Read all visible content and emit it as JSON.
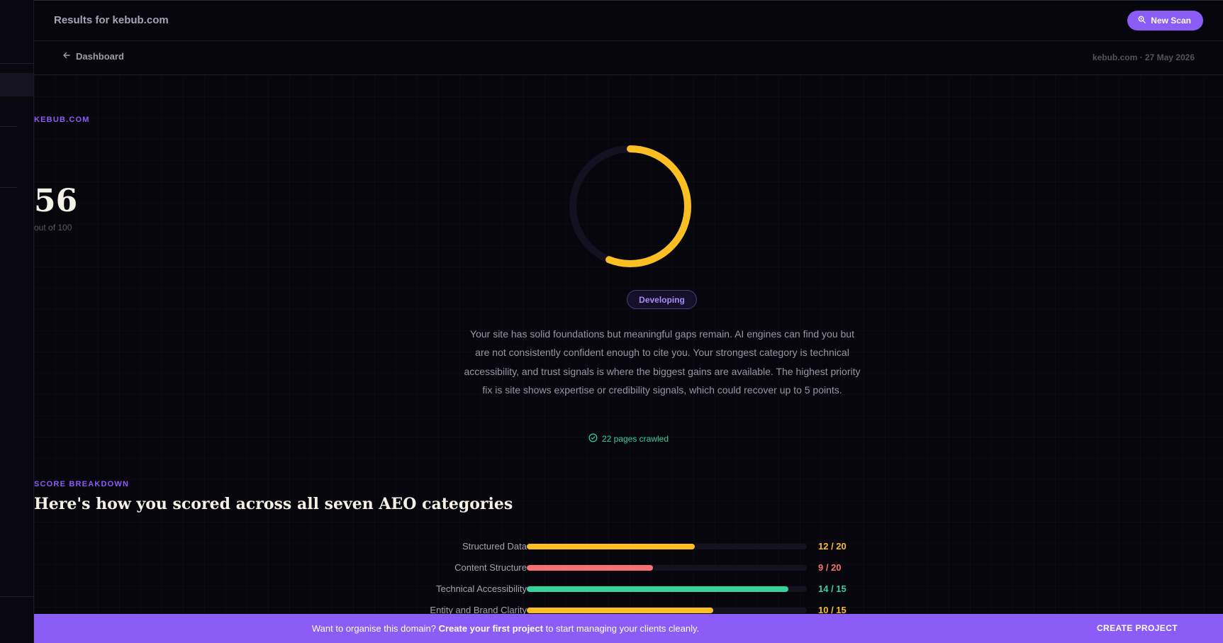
{
  "topbar": {
    "title": "Results for kebub.com",
    "new_scan_label": "New Scan"
  },
  "subbar": {
    "back_label": "Dashboard",
    "meta": "kebub.com · 27 May 2026"
  },
  "score": {
    "domain": "KEBUB.COM",
    "value": "56",
    "out_of": "out of 100",
    "fraction": 0.56,
    "color": "#fbbf24",
    "badge": "Developing",
    "summary": "Your site has solid foundations but meaningful gaps remain. AI engines can find you but are not consistently confident enough to cite you. Your strongest category is technical accessibility, and trust signals is where the biggest gains are available. The highest priority fix is site shows expertise or credibility signals, which could recover up to 5 points.",
    "crawled": "22 pages crawled"
  },
  "breakdown": {
    "label": "SCORE BREAKDOWN",
    "title": "Here's how you scored across all seven AEO categories",
    "rows": [
      {
        "label": "Structured Data",
        "score": "12 / 20",
        "fraction": 0.6,
        "color": "#fbbf24"
      },
      {
        "label": "Content Structure",
        "score": "9 / 20",
        "fraction": 0.45,
        "color": "#f87171"
      },
      {
        "label": "Technical Accessibility",
        "score": "14 / 15",
        "fraction": 0.933,
        "color": "#34d399"
      },
      {
        "label": "Entity and Brand Clarity",
        "score": "10 / 15",
        "fraction": 0.667,
        "color": "#fbbf24"
      }
    ]
  },
  "cta": {
    "prefix": "Want to organise this domain? ",
    "link": "Create your first project",
    "suffix": " to start managing your clients cleanly.",
    "button": "CREATE PROJECT"
  },
  "icons": {
    "new_scan": "search-icon",
    "back": "arrow-left-icon",
    "crawled": "check-circle-icon"
  }
}
